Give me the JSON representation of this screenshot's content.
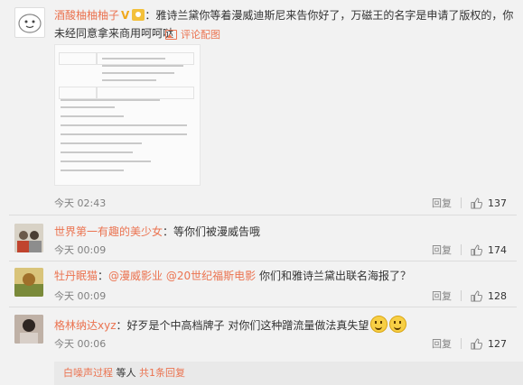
{
  "comments": [
    {
      "user": "酒酸柚柚柚子",
      "badge": "V",
      "text_line1": "：雅诗兰黛你等着漫威迪斯尼来告你好了，万磁王的名字是申请了版权的，你",
      "text_line2": "未经同意拿来商用呵呵哒",
      "image_link": "评论配图",
      "time": "今天 02:43",
      "reply": "回复",
      "likes": "137",
      "avatar_color": "#ffffff"
    },
    {
      "user": "世界第一有趣的美少女",
      "text": "：等你们被漫威告哦",
      "time": "今天 00:09",
      "reply": "回复",
      "likes": "174",
      "avatar_color": "#b9b3a8"
    },
    {
      "user": "牡丹眠猫",
      "mention1": "@漫威影业",
      "mention2": "@20世纪福斯电影",
      "text": "你们和雅诗兰黛出联名海报了？",
      "time": "今天 00:09",
      "reply": "回复",
      "likes": "128",
      "avatar_color": "#c9b46a"
    },
    {
      "user": "格林纳达xyz",
      "text": "：好歹是个中高档牌子 对你们这种蹭流量做法真失望",
      "time": "今天 00:06",
      "reply": "回复",
      "likes": "127",
      "avatar_color": "#8c7a6e"
    }
  ],
  "sub_reply": {
    "user": "白噪声过程",
    "text": "等人",
    "link": "共1条回复"
  },
  "colors": {
    "accent": "#eb7350",
    "muted": "#808080",
    "background": "#f2f2f2"
  }
}
